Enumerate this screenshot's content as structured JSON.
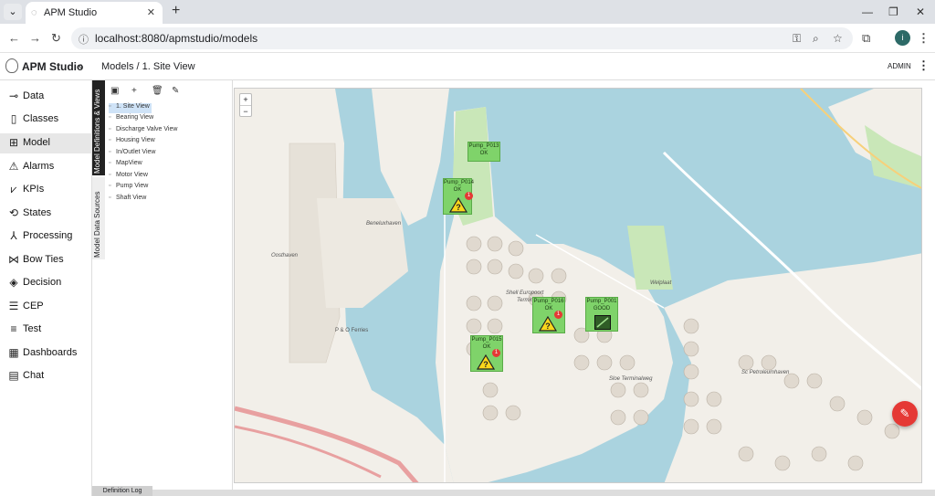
{
  "browser": {
    "tab_title": "APM Studio",
    "url": "localhost:8080/apmstudio/models",
    "profile_initial": "i"
  },
  "app": {
    "name": "APM Studio",
    "breadcrumb": "Models / 1. Site View",
    "user": "ADMIN"
  },
  "sidebar": {
    "items": [
      {
        "label": "Data",
        "icon": "data-flow-icon"
      },
      {
        "label": "Classes",
        "icon": "class-book-icon"
      },
      {
        "label": "Model",
        "icon": "model-grid-icon",
        "active": true
      },
      {
        "label": "Alarms",
        "icon": "warning-icon"
      },
      {
        "label": "KPIs",
        "icon": "trend-chart-icon"
      },
      {
        "label": "States",
        "icon": "states-loop-icon"
      },
      {
        "label": "Processing",
        "icon": "processing-nodes-icon"
      },
      {
        "label": "Bow Ties",
        "icon": "bow-tie-icon"
      },
      {
        "label": "Decision",
        "icon": "decision-icon"
      },
      {
        "label": "CEP",
        "icon": "cep-list-icon"
      },
      {
        "label": "Test",
        "icon": "test-checklist-icon"
      },
      {
        "label": "Dashboards",
        "icon": "dashboard-icon"
      },
      {
        "label": "Chat",
        "icon": "chat-icon"
      }
    ]
  },
  "vertical_tabs": {
    "definitions": "Model Definitions & Views",
    "sources": "Model Data Sources"
  },
  "tree": {
    "items": [
      {
        "label": "1. Site View",
        "selected": true
      },
      {
        "label": "Bearing View"
      },
      {
        "label": "Discharge Valve View"
      },
      {
        "label": "Housing View"
      },
      {
        "label": "In/Outlet View"
      },
      {
        "label": "MapView"
      },
      {
        "label": "Motor View"
      },
      {
        "label": "Pump View"
      },
      {
        "label": "Shaft View"
      }
    ]
  },
  "map": {
    "zoom_in": "+",
    "zoom_out": "−",
    "labels": {
      "beneluxhaven": "Beneluxhaven",
      "oosthaven": "Oosthaven",
      "po_ferries": "P & O Ferries",
      "shell": "Shell Europoort",
      "terminal": "Terminal",
      "seine": "Sin-Terminalweg",
      "sloe": "Sloe Terminalweg",
      "welplaat": "Welplaat",
      "scheurhaven": "Sc Petroleumhaven"
    },
    "pumps": [
      {
        "name": "Pump_P013",
        "status": "OK"
      },
      {
        "name": "Pump_P014",
        "status": "OK",
        "alarms": "1"
      },
      {
        "name": "Pump_P016",
        "status": "OK",
        "alarms": "1"
      },
      {
        "name": "Pump_P001",
        "status": "GOOD"
      },
      {
        "name": "Pump_P015",
        "status": "OK",
        "alarms": "1"
      }
    ]
  },
  "footer": {
    "definition_log": "Definition Log"
  },
  "colors": {
    "accent": "#e53935",
    "pump_fill": "#7fd36a",
    "water": "#aad3df",
    "land": "#f2efe9"
  }
}
